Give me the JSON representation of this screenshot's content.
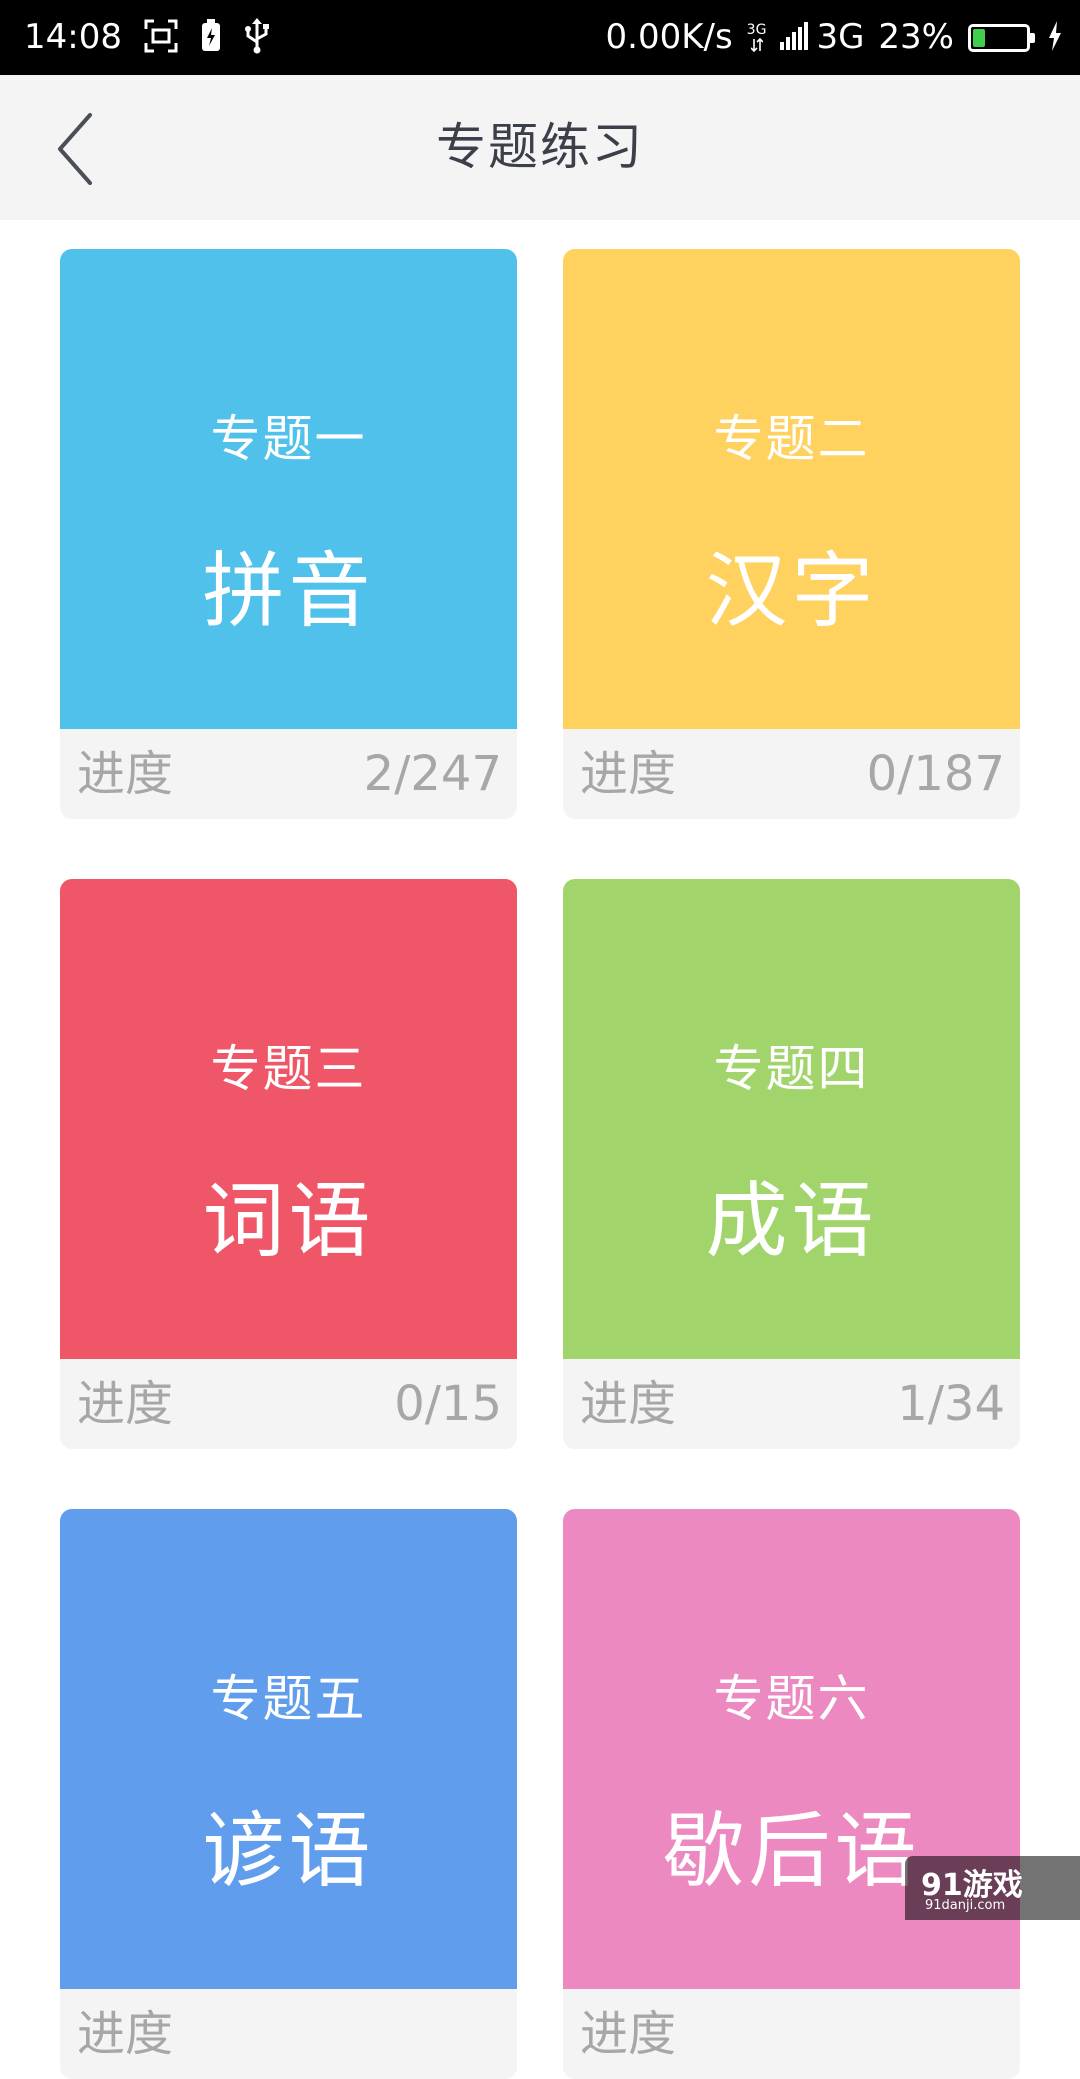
{
  "status_bar": {
    "time": "14:08",
    "net_speed": "0.00K/s",
    "network_small": "3G",
    "network": "3G",
    "battery_percent_text": "23%",
    "battery_level": 0.23,
    "icons": [
      "screenshot-icon",
      "battery-saver-icon",
      "usb-icon",
      "signal-icon",
      "charging-icon"
    ]
  },
  "header": {
    "title": "专题练习",
    "back_icon": "chevron-left-icon"
  },
  "cards": [
    {
      "subtitle": "专题一",
      "title": "拼音",
      "progress_label": "进度",
      "progress_value": "2/247",
      "color": "#4FC1EA"
    },
    {
      "subtitle": "专题二",
      "title": "汉字",
      "progress_label": "进度",
      "progress_value": "0/187",
      "color": "#FFD15F"
    },
    {
      "subtitle": "专题三",
      "title": "词语",
      "progress_label": "进度",
      "progress_value": "0/15",
      "color": "#EF5667"
    },
    {
      "subtitle": "专题四",
      "title": "成语",
      "progress_label": "进度",
      "progress_value": "1/34",
      "color": "#A1D56B"
    },
    {
      "subtitle": "专题五",
      "title": "谚语",
      "progress_label": "进度",
      "progress_value": "",
      "color": "#609DEC"
    },
    {
      "subtitle": "专题六",
      "title": "歇后语",
      "progress_label": "进度",
      "progress_value": "",
      "color": "#EC89C1"
    }
  ],
  "watermark": {
    "main": "91游戏",
    "sub": "91danji.com"
  }
}
